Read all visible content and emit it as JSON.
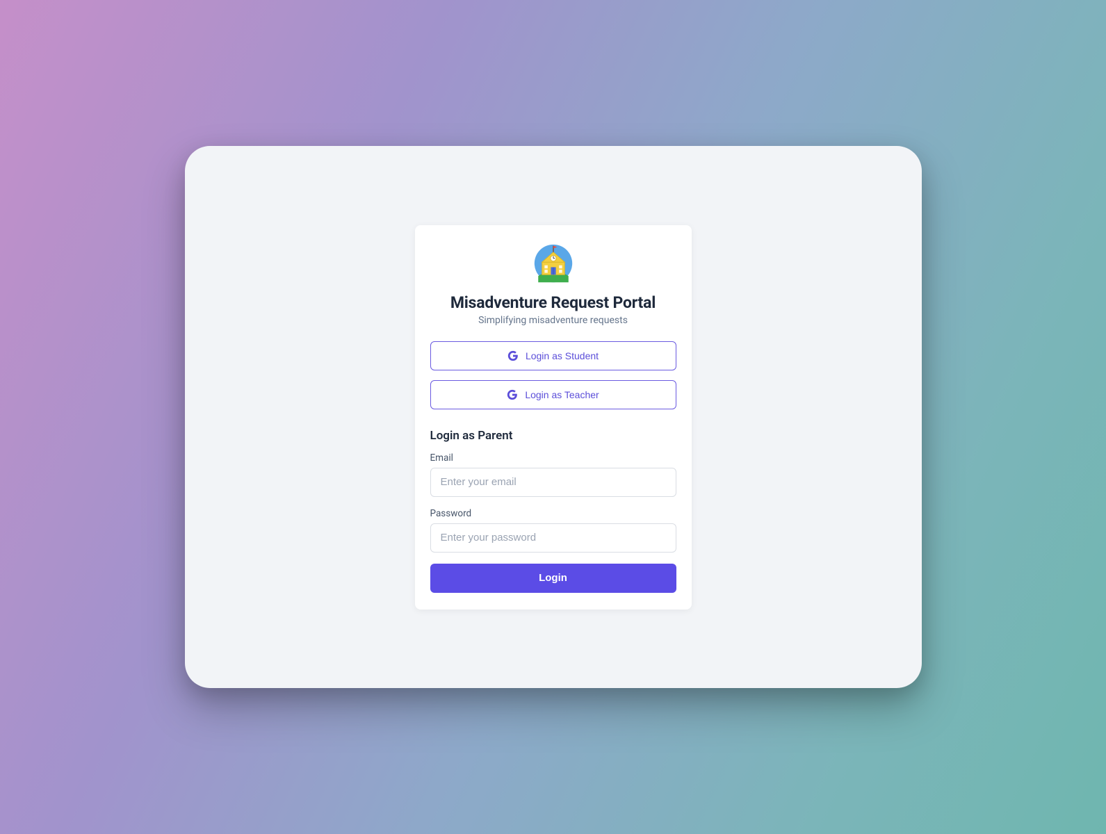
{
  "header": {
    "title": "Misadventure Request Portal",
    "subtitle": "Simplifying misadventure requests"
  },
  "oauth": {
    "student_label": "Login as Student",
    "teacher_label": "Login as Teacher"
  },
  "parent_section": {
    "heading": "Login as Parent",
    "email_label": "Email",
    "email_placeholder": "Enter your email",
    "email_value": "",
    "password_label": "Password",
    "password_placeholder": "Enter your password",
    "password_value": "",
    "login_button_label": "Login"
  },
  "colors": {
    "accent": "#5b4ce6",
    "outline": "#6a5ae0",
    "text_heading": "#1e293b",
    "text_muted": "#64748b"
  },
  "icons": {
    "google": "google-g-icon",
    "logo": "school-building-icon"
  }
}
